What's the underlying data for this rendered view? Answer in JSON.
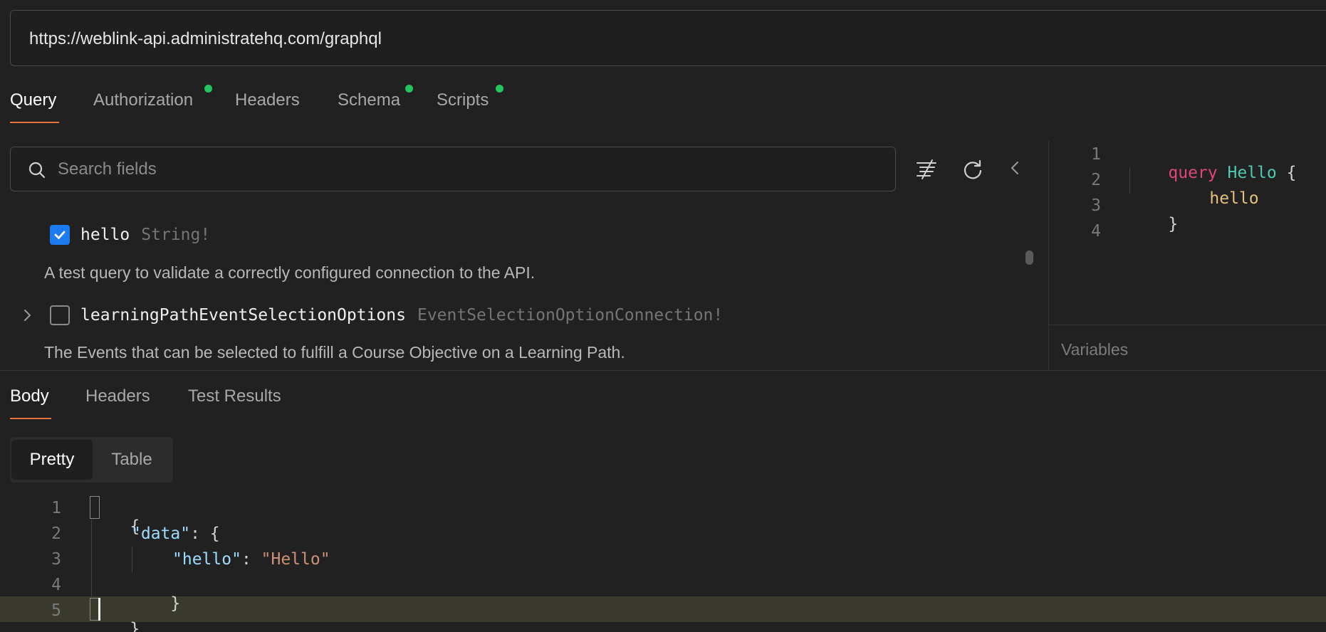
{
  "request": {
    "url": "https://weblink-api.administratehq.com/graphql"
  },
  "request_tabs": [
    {
      "label": "Query",
      "active": true,
      "dot": false
    },
    {
      "label": "Authorization",
      "active": false,
      "dot": true
    },
    {
      "label": "Headers",
      "active": false,
      "dot": false
    },
    {
      "label": "Schema",
      "active": false,
      "dot": true
    },
    {
      "label": "Scripts",
      "active": false,
      "dot": true
    }
  ],
  "accent_color": "#e5733a",
  "dot_color": "#22c55e",
  "search": {
    "placeholder": "Search fields",
    "value": ""
  },
  "toolbar_icons": [
    "prettify-icon",
    "refresh-icon",
    "collapse-chevron-left-icon"
  ],
  "fields": [
    {
      "name": "hello",
      "type": "String!",
      "checked": true,
      "expandable": false,
      "description": "A test query to validate a correctly configured connection to the API."
    },
    {
      "name": "learningPathEventSelectionOptions",
      "type": "EventSelectionOptionConnection!",
      "checked": false,
      "expandable": true,
      "description": "The Events that can be selected to fulfill a Course Objective on a Learning Path."
    }
  ],
  "query_editor": {
    "line_numbers": [
      "1",
      "2",
      "3",
      "4"
    ],
    "keyword": "query",
    "operation_name": "Hello",
    "open_brace": "{",
    "field": "hello",
    "close_brace": "}"
  },
  "variables": {
    "label": "Variables"
  },
  "response_tabs": [
    {
      "label": "Body",
      "active": true
    },
    {
      "label": "Headers",
      "active": false
    },
    {
      "label": "Test Results",
      "active": false
    }
  ],
  "view_toggle": {
    "pretty": "Pretty",
    "table": "Table",
    "selected": "Pretty"
  },
  "response_body": {
    "line_numbers": [
      "1",
      "2",
      "3",
      "4",
      "5"
    ],
    "open_brace": "{",
    "data_key": "\"data\"",
    "colon": ": ",
    "inner_open": "{",
    "hello_key": "\"hello\"",
    "hello_value": "\"Hello\"",
    "inner_close": "}",
    "close_brace": "}"
  }
}
